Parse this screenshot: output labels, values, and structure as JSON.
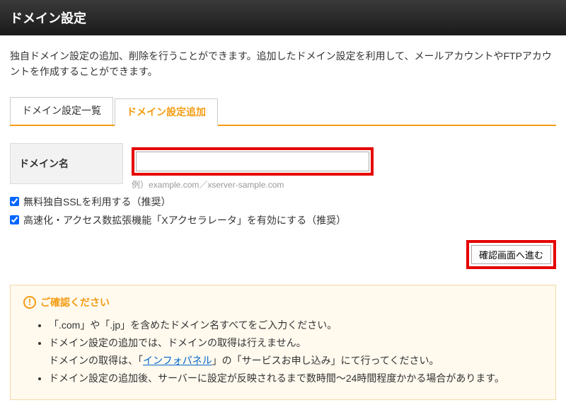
{
  "header": {
    "title": "ドメイン設定"
  },
  "description": "独自ドメイン設定の追加、削除を行うことができます。追加したドメイン設定を利用して、メールアカウントやFTPアカウントを作成することができます。",
  "tabs": {
    "list": "ドメイン設定一覧",
    "add": "ドメイン設定追加"
  },
  "form": {
    "domain_label": "ドメイン名",
    "domain_value": "",
    "example": "例）example.com／xserver-sample.com",
    "ssl_label": "無料独自SSLを利用する（推奨）",
    "xaccel_label": "高速化・アクセス数拡張機能「Xアクセラレータ」を有効にする（推奨）",
    "submit_label": "確認画面へ進む"
  },
  "notice": {
    "title": "ご確認ください",
    "items": {
      "i1": "「.com」や「.jp」を含めたドメイン名すべてをご入力ください。",
      "i2": "ドメイン設定の追加では、ドメインの取得は行えません。",
      "i2_sub_pre": "ドメインの取得は、「",
      "i2_link": "インフォパネル",
      "i2_sub_post": "」の「サービスお申し込み」にて行ってください。",
      "i3": "ドメイン設定の追加後、サーバーに設定が反映されるまで数時間～24時間程度かかる場合があります。"
    }
  }
}
